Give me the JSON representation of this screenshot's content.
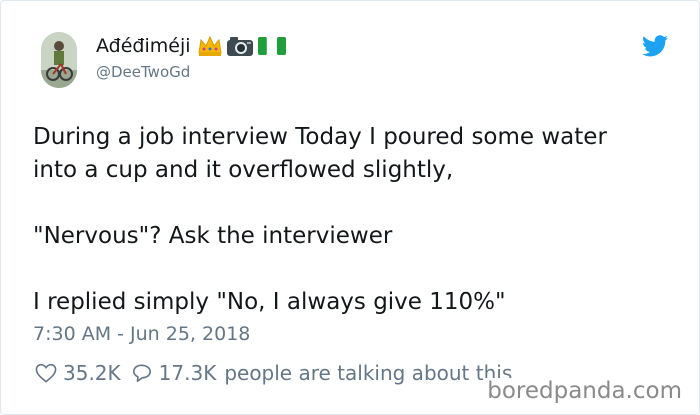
{
  "author": {
    "display_name": "Ađéđiméji",
    "handle": "@DeeTwoGd",
    "emojis": [
      "crown-emoji",
      "camera-emoji",
      "nigeria-flag-emoji"
    ]
  },
  "tweet": {
    "lines": [
      "During a job interview Today I poured some water",
      "into a cup and it overflowed slightly,",
      "",
      "\"Nervous\"? Ask the interviewer",
      "",
      "I replied simply \"No, I always give 110%\""
    ],
    "timestamp": "7:30 AM - Jun 25, 2018"
  },
  "stats": {
    "likes": "35.2K",
    "replies": "17.3K",
    "talking_text": "people are talking about this"
  },
  "watermark": "boredpanda.com",
  "colors": {
    "twitter_blue": "#1da1f2",
    "secondary_text": "#657786",
    "primary_text": "#14171a",
    "crown": "#f5b800",
    "flag_green": "#1f9e3a"
  }
}
